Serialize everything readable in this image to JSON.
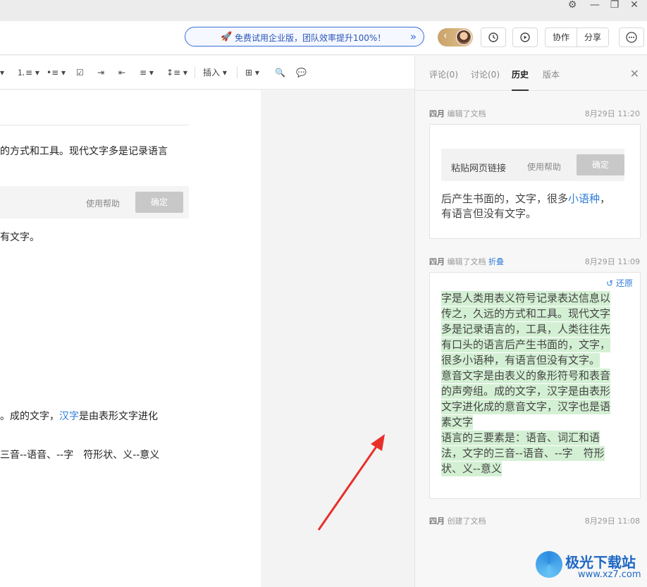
{
  "header": {
    "promo_text": "免费试用企业版，团队效率提升100%！",
    "collab_label": "协作",
    "share_label": "分享"
  },
  "toolbar": {
    "insert_label": "插入"
  },
  "doc": {
    "line1": "的方式和工具。现代文字多是记录语言",
    "help_label": "使用帮助",
    "ok_label": "确定",
    "line2": "有文字。",
    "line3_a": "。成的文字，",
    "line3_link": "汉字",
    "line3_b": "是由表形文字进化",
    "line4": "三音--语音、--字　符形状、义--意义"
  },
  "panel": {
    "tabs": [
      "评论(0)",
      "讨论(0)",
      "历史",
      "版本"
    ],
    "active_tab": "历史",
    "entries": [
      {
        "author": "四月",
        "action": "编辑了文档",
        "time": "8月29日 11:20",
        "paste_label": "粘贴网页链接",
        "help_label": "使用帮助",
        "ok_label": "确定",
        "line1_a": "后产生书面的，文字，很多",
        "line1_link": "小语种",
        "line1_b": "，",
        "line2": "有语言但没有文字。"
      },
      {
        "author": "四月",
        "action": "编辑了文档",
        "fold_label": "折叠",
        "time": "8月29日 11:09",
        "restore_label": "还原",
        "lines": [
          "字是人类用表义符号记录表达信息以",
          "传之，久远的方式和工具。现代文字",
          "多是记录语言的，工具，人类往往先",
          "有口头的语言后产生书面的，文字，",
          "很多小语种，有语言但没有文字。",
          "意音文字是由表义的象形符号和表音",
          "的声旁组。成的文字，汉字是由表形",
          "文字进化成的意音文字，汉字也是语",
          "素文字",
          "语言的三要素是：语音、词汇和语",
          "法，文字的三音--语音、--字　符形",
          "状、义--意义"
        ]
      },
      {
        "author": "四月",
        "action": "创建了文档",
        "time": "8月29日 11:08"
      }
    ]
  },
  "watermark": {
    "name": "极光下载站",
    "url": "www.xz7.com"
  },
  "colors": {
    "accent_blue": "#2f7ed8",
    "highlight_green": "#d4f0d4",
    "arrow_red": "#e8302a"
  }
}
